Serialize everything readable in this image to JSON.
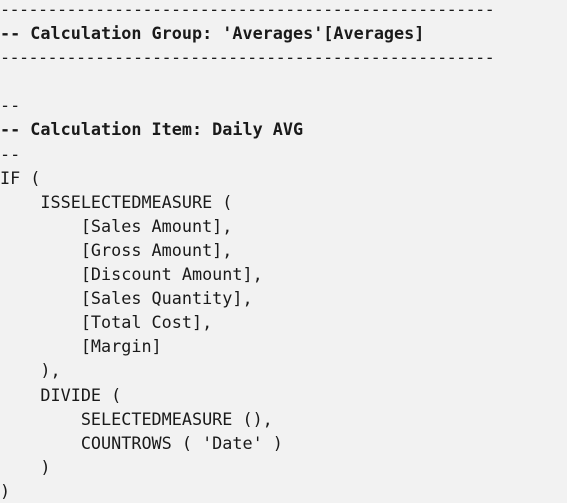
{
  "code": {
    "lines": [
      {
        "text": "----------------------------------------------------",
        "style": "rule"
      },
      {
        "text": "-- Calculation Group: 'Averages'[Averages]",
        "style": "bold"
      },
      {
        "text": "----------------------------------------------------",
        "style": "rule"
      },
      {
        "text": "",
        "style": "normal"
      },
      {
        "text": "--",
        "style": "normal"
      },
      {
        "text": "-- Calculation Item: Daily AVG",
        "style": "bold"
      },
      {
        "text": "--",
        "style": "normal"
      },
      {
        "text": "IF (",
        "style": "normal"
      },
      {
        "text": "    ISSELECTEDMEASURE (",
        "style": "normal"
      },
      {
        "text": "        [Sales Amount],",
        "style": "normal"
      },
      {
        "text": "        [Gross Amount],",
        "style": "normal"
      },
      {
        "text": "        [Discount Amount],",
        "style": "normal"
      },
      {
        "text": "        [Sales Quantity],",
        "style": "normal"
      },
      {
        "text": "        [Total Cost],",
        "style": "normal"
      },
      {
        "text": "        [Margin]",
        "style": "normal"
      },
      {
        "text": "    ),",
        "style": "normal"
      },
      {
        "text": "    DIVIDE (",
        "style": "normal"
      },
      {
        "text": "        SELECTEDMEASURE (),",
        "style": "normal"
      },
      {
        "text": "        COUNTROWS ( 'Date' )",
        "style": "normal"
      },
      {
        "text": "    )",
        "style": "normal"
      },
      {
        "text": ")",
        "style": "normal"
      }
    ]
  }
}
